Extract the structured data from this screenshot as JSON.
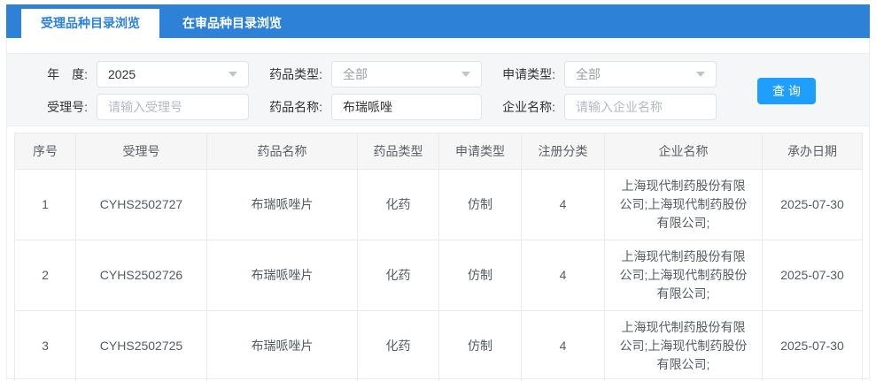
{
  "colors": {
    "accent": "#2d82d7",
    "button": "#1e9fff",
    "panel_bg": "#f5f6f8",
    "table_border": "#e8eaec"
  },
  "tabs": [
    {
      "label": "受理品种目录浏览",
      "active": true
    },
    {
      "label": "在审品种目录浏览",
      "active": false
    }
  ],
  "filters": {
    "year": {
      "label": "年　度:",
      "value": "2025"
    },
    "drug_type": {
      "label": "药品类型:",
      "value": "全部"
    },
    "apply_type": {
      "label": "申请类型:",
      "value": "全部"
    },
    "acceptance_no": {
      "label": "受理号:",
      "placeholder": "请输入受理号"
    },
    "drug_name": {
      "label": "药品名称:",
      "value": "布瑞哌唑"
    },
    "company_name": {
      "label": "企业名称:",
      "placeholder": "请输入企业名称"
    },
    "search_label": "查 询"
  },
  "table": {
    "headers": [
      "序号",
      "受理号",
      "药品名称",
      "药品类型",
      "申请类型",
      "注册分类",
      "企业名称",
      "承办日期"
    ],
    "rows": [
      [
        "1",
        "CYHS2502727",
        "布瑞哌唑片",
        "化药",
        "仿制",
        "4",
        "上海现代制药股份有限公司;上海现代制药股份有限公司;",
        "2025-07-30"
      ],
      [
        "2",
        "CYHS2502726",
        "布瑞哌唑片",
        "化药",
        "仿制",
        "4",
        "上海现代制药股份有限公司;上海现代制药股份有限公司;",
        "2025-07-30"
      ],
      [
        "3",
        "CYHS2502725",
        "布瑞哌唑片",
        "化药",
        "仿制",
        "4",
        "上海现代制药股份有限公司;上海现代制药股份有限公司;",
        "2025-07-30"
      ]
    ]
  }
}
